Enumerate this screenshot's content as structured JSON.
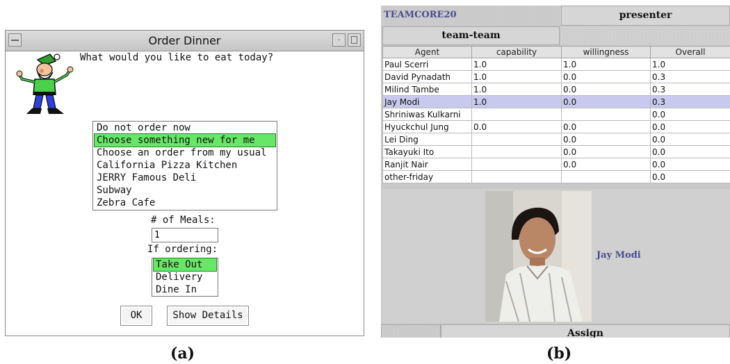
{
  "panel_a": {
    "window_title": "Order Dinner",
    "question": "What would you like to eat today?",
    "restaurant_options": [
      {
        "label": "Do not order now",
        "selected": false
      },
      {
        "label": "Choose something new for me",
        "selected": true
      },
      {
        "label": "Choose an order from my usual",
        "selected": false
      },
      {
        "label": "California Pizza Kitchen",
        "selected": false
      },
      {
        "label": "JERRY Famous Deli",
        "selected": false
      },
      {
        "label": "Subway",
        "selected": false
      },
      {
        "label": "Zebra Cafe",
        "selected": false
      }
    ],
    "meals_label": "# of Meals:",
    "meals_value": "1",
    "ordering_label": "If ordering:",
    "ordering_options": [
      {
        "label": "Take Out",
        "selected": true
      },
      {
        "label": "Delivery",
        "selected": false
      },
      {
        "label": "Dine In",
        "selected": false
      }
    ],
    "ok_label": "OK",
    "details_label": "Show Details",
    "caption": "(a)",
    "selection_color": "#66e866"
  },
  "panel_b": {
    "app_title": "TEAMCORE20",
    "presenter_tab": "presenter",
    "team_tab": "team-team",
    "table": {
      "headers": [
        "Agent",
        "capability",
        "willingness",
        "Overall"
      ],
      "rows": [
        {
          "cells": [
            "Paul Scerri",
            "1.0",
            "1.0",
            "1.0"
          ],
          "selected": false
        },
        {
          "cells": [
            "David Pynadath",
            "1.0",
            "0.0",
            "0.3"
          ],
          "selected": false
        },
        {
          "cells": [
            "Milind Tambe",
            "1.0",
            "0.0",
            "0.3"
          ],
          "selected": false
        },
        {
          "cells": [
            "Jay Modi",
            "1.0",
            "0.0",
            "0.3"
          ],
          "selected": true
        },
        {
          "cells": [
            "Shriniwas Kulkarni",
            "",
            "",
            "0.0"
          ],
          "selected": false
        },
        {
          "cells": [
            "Hyuckchul Jung",
            "0.0",
            "0.0",
            "0.0"
          ],
          "selected": false
        },
        {
          "cells": [
            "Lei Ding",
            "",
            "0.0",
            "0.0"
          ],
          "selected": false
        },
        {
          "cells": [
            "Takayuki Ito",
            "",
            "0.0",
            "0.0"
          ],
          "selected": false
        },
        {
          "cells": [
            "Ranjit Nair",
            "",
            "0.0",
            "0.0"
          ],
          "selected": false
        },
        {
          "cells": [
            "other-friday",
            "",
            "",
            "0.0"
          ],
          "selected": false
        }
      ]
    },
    "photo_name": "Jay Modi",
    "assign_label": "Assign",
    "caption": "(b)",
    "accent_color": "#4b4b8f",
    "selected_row_color": "#c9c9ee"
  }
}
